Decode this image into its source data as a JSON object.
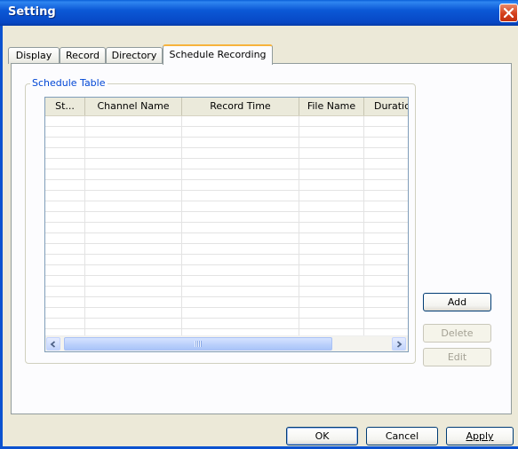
{
  "window": {
    "title": "Setting"
  },
  "tabs": [
    {
      "label": "Display"
    },
    {
      "label": "Record"
    },
    {
      "label": "Directory"
    },
    {
      "label": "Schedule Recording"
    }
  ],
  "schedule_group": {
    "title": "Schedule Table"
  },
  "table": {
    "columns": [
      {
        "label": "St..."
      },
      {
        "label": "Channel Name"
      },
      {
        "label": "Record Time"
      },
      {
        "label": "File Name"
      },
      {
        "label": "Duratic"
      }
    ],
    "rows": []
  },
  "side_buttons": {
    "add": "Add",
    "delete": "Delete",
    "edit": "Edit"
  },
  "footer": {
    "ok": "OK",
    "cancel": "Cancel",
    "apply": "Apply"
  },
  "icons": {
    "close": "close-icon",
    "scroll_left": "arrow-left-icon",
    "scroll_right": "arrow-right-icon"
  },
  "colors": {
    "titlebar": "#0b58d6",
    "active_tab_accent": "#f7b33c",
    "group_title": "#0046d5",
    "disabled_text": "#a3a093"
  }
}
